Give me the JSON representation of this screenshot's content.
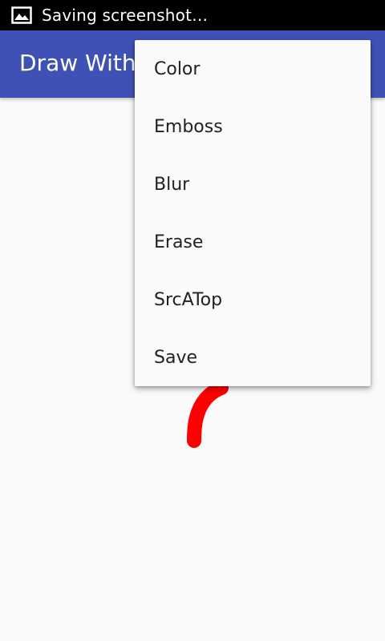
{
  "status_bar": {
    "notification_icon": "image-icon",
    "text": "Saving screenshot…"
  },
  "app_bar": {
    "title": "Draw With",
    "color": "#3f51b5"
  },
  "canvas": {
    "background": "#fafafa",
    "stroke_color": "#ff0000"
  },
  "menu": {
    "items": [
      {
        "label": "Color"
      },
      {
        "label": "Emboss"
      },
      {
        "label": "Blur"
      },
      {
        "label": "Erase"
      },
      {
        "label": "SrcATop"
      },
      {
        "label": "Save"
      }
    ]
  }
}
